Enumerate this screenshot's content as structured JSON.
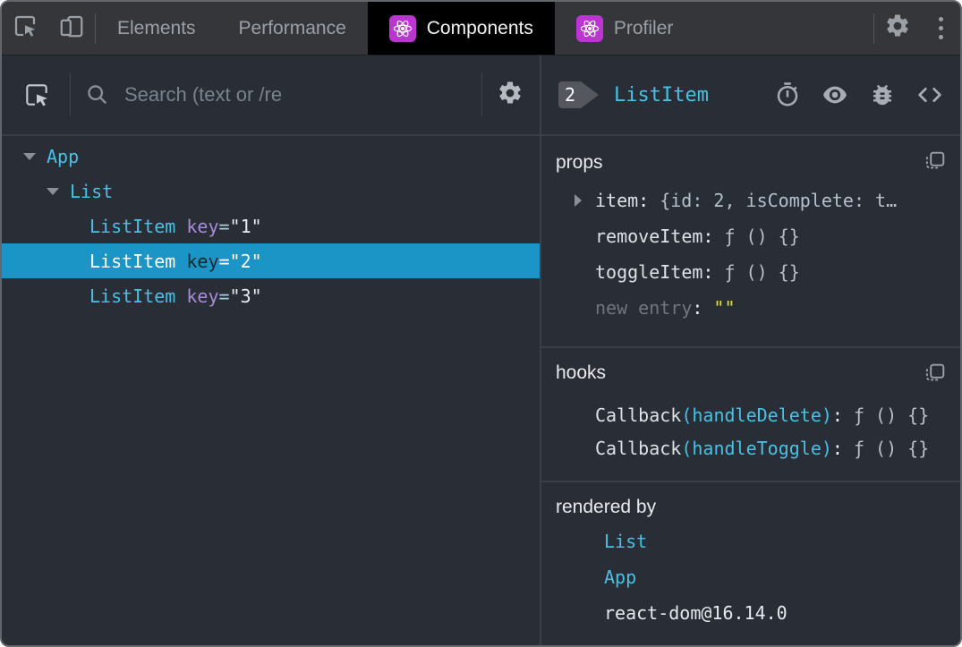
{
  "colors": {
    "accent_cyan": "#49c1e4",
    "accent_purple": "#a78bd9",
    "selected_row_bg": "#1b94c6",
    "value_yellow": "#e9e41a",
    "react_badge_bg": "#bb36d0",
    "active_tab_bg": "#000000",
    "toolbar_bg": "#35363a",
    "panel_bg": "#282d36"
  },
  "toolbar": {
    "tabs": {
      "elements": "Elements",
      "performance": "Performance",
      "components": "Components",
      "profiler": "Profiler"
    }
  },
  "left_panel": {
    "search_placeholder": "Search (text or /re"
  },
  "tree": {
    "rows": [
      {
        "name": "App"
      },
      {
        "name": "List"
      },
      {
        "name": "ListItem",
        "attr": "key",
        "eq": "=",
        "value": "\"1\""
      },
      {
        "name": "ListItem",
        "attr": "key",
        "eq": "=",
        "value": "\"2\""
      },
      {
        "name": "ListItem",
        "attr": "key",
        "eq": "=",
        "value": "\"3\""
      }
    ]
  },
  "inspector": {
    "selected_index_badge": "2",
    "title": "ListItem",
    "props": {
      "title": "props",
      "rows": [
        {
          "key": "item",
          "colon": ":",
          "value": "{id: 2, isComplete: t…"
        },
        {
          "key": "removeItem",
          "colon": ":",
          "value": "ƒ () {}"
        },
        {
          "key": "toggleItem",
          "colon": ":",
          "value": "ƒ () {}"
        },
        {
          "key": "new entry",
          "colon": ":",
          "value": "\"\""
        }
      ]
    },
    "hooks": {
      "title": "hooks",
      "rows": [
        {
          "name": "Callback",
          "arg": "(handleDelete)",
          "colon": ":",
          "value": "ƒ () {}"
        },
        {
          "name": "Callback",
          "arg": "(handleToggle)",
          "colon": ":",
          "value": "ƒ () {}"
        }
      ]
    },
    "rendered_by": {
      "title": "rendered by",
      "items": [
        {
          "label": "List"
        },
        {
          "label": "App"
        },
        {
          "label": "react-dom@16.14.0"
        }
      ]
    }
  }
}
